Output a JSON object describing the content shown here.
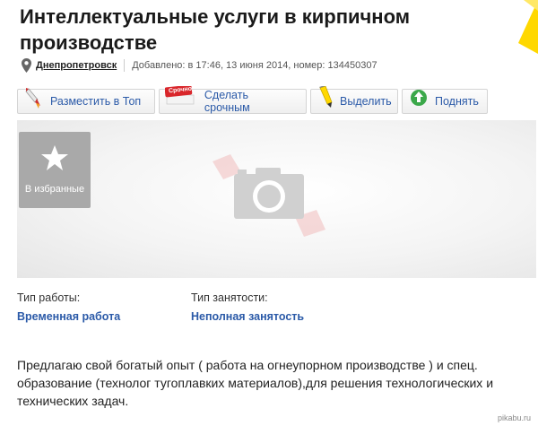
{
  "listing": {
    "title": "Интеллектуальные услуги в кирпичном производстве",
    "city": "Днепропетровск",
    "added": "Добавлено: в 17:46, 13 июня 2014, номер: 134450307"
  },
  "actions": [
    {
      "label": "Разместить в Топ",
      "icon": "rocket-icon"
    },
    {
      "label": "Сделать срочным",
      "icon": "urgent-tag-icon",
      "badge": "Срочно"
    },
    {
      "label": "Выделить",
      "icon": "marker-pencil-icon"
    },
    {
      "label": "Поднять",
      "icon": "up-arrow-icon"
    }
  ],
  "gallery": {
    "favorite_label": "В избранные"
  },
  "fields": {
    "work_type_label": "Тип работы:",
    "work_type_value": "Временная работа",
    "employment_label": "Тип занятости:",
    "employment_value": "Неполная занятость"
  },
  "description": "Предлагаю свой богатый опыт ( работа на огнеупорном производстве ) и спец. образование (технолог тугоплавких материалов),для решения технологических и технических задач.",
  "watermark": "pikabu.ru",
  "colors": {
    "link": "#2b5aa8",
    "accent_yellow": "#ffd800",
    "urgent_red": "#d9262b"
  }
}
